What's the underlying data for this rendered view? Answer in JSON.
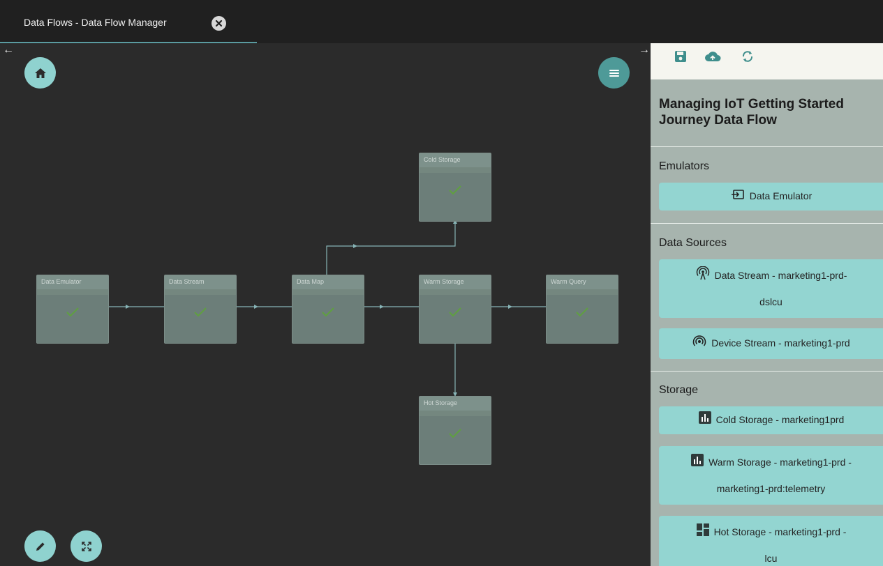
{
  "tab": {
    "title": "Data Flows - Data Flow Manager"
  },
  "canvas": {
    "nodes": {
      "data_emulator": "Data Emulator",
      "data_stream": "Data Stream",
      "data_map": "Data Map",
      "warm_storage": "Warm Storage",
      "warm_query": "Warm Query",
      "cold_storage": "Cold Storage",
      "hot_storage": "Hot Storage"
    }
  },
  "panel": {
    "title": "Managing IoT Getting Started Journey Data Flow",
    "sections": {
      "emulators": "Emulators",
      "data_sources": "Data Sources",
      "storage": "Storage"
    },
    "items": {
      "data_emulator": "Data Emulator",
      "data_stream_line1": "Data Stream - marketing1-prd-",
      "data_stream_line2": "dslcu",
      "device_stream": "Device Stream - marketing1-prd",
      "cold_storage": "Cold Storage - marketing1prd",
      "warm_storage_line1": "Warm Storage - marketing1-prd -",
      "warm_storage_line2": "marketing1-prd:telemetry",
      "hot_storage_line1": "Hot Storage - marketing1-prd -",
      "hot_storage_line2": "lcu"
    }
  },
  "colors": {
    "accent": "#93d5d1",
    "accent_dark": "#4e9a98",
    "node": "#6c7e79",
    "check": "#5fa040"
  }
}
